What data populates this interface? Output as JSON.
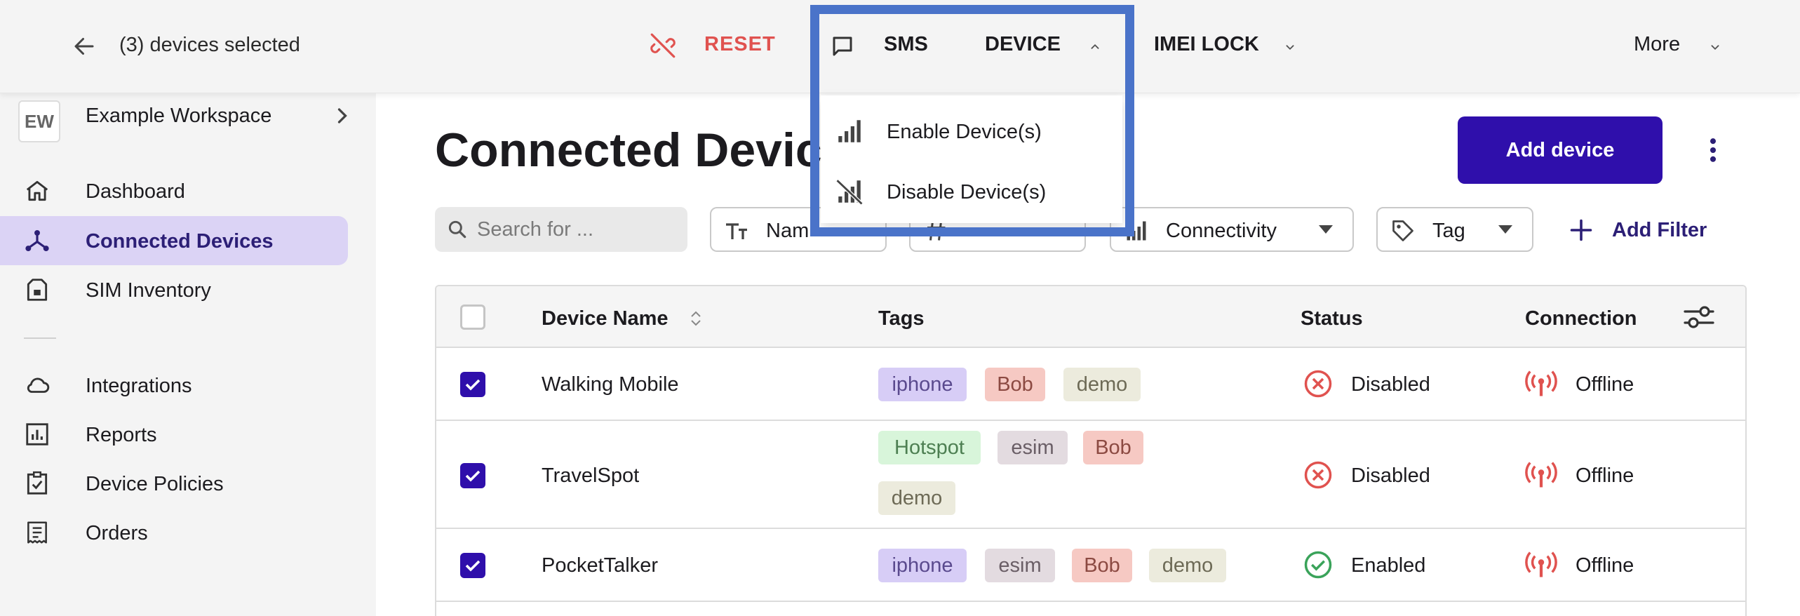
{
  "topbar": {
    "selection_text": "(3) devices selected",
    "reset_label": "RESET",
    "sms_label": "SMS",
    "device_label": "DEVICE",
    "imei_label": "IMEI LOCK",
    "more_label": "More"
  },
  "device_menu": {
    "items": [
      {
        "label": "Enable Device(s)",
        "icon": "signal-bars-icon"
      },
      {
        "label": "Disable Device(s)",
        "icon": "signal-off-icon"
      }
    ]
  },
  "highlight_color": "#4a73c9",
  "sidebar": {
    "workspace_initials": "EW",
    "workspace_name": "Example Workspace",
    "items": [
      {
        "label": "Dashboard",
        "icon": "home-icon"
      },
      {
        "label": "Connected Devices",
        "icon": "network-icon",
        "active": true
      },
      {
        "label": "SIM Inventory",
        "icon": "sim-card-icon"
      },
      {
        "label": "Integrations",
        "icon": "cloud-icon"
      },
      {
        "label": "Reports",
        "icon": "bar-report-icon"
      },
      {
        "label": "Device Policies",
        "icon": "clipboard-check-icon"
      },
      {
        "label": "Orders",
        "icon": "receipt-icon"
      }
    ]
  },
  "main": {
    "title": "Connected Devic",
    "add_device_label": "Add device",
    "search_placeholder": "Search for ...",
    "filters": {
      "name_label": "Nam",
      "connectivity_label": "Connectivity",
      "tag_label": "Tag",
      "add_filter_label": "Add Filter"
    }
  },
  "table": {
    "columns": {
      "device_name": "Device Name",
      "tags": "Tags",
      "status": "Status",
      "connection": "Connection"
    },
    "rows": [
      {
        "name": "Walking Mobile",
        "tags": [
          "iphone",
          "Bob",
          "demo"
        ],
        "status": "Disabled",
        "connection": "Offline",
        "checked": true
      },
      {
        "name": "TravelSpot",
        "tags": [
          "Hotspot",
          "esim",
          "Bob",
          "demo"
        ],
        "status": "Disabled",
        "connection": "Offline",
        "checked": true
      },
      {
        "name": "PocketTalker",
        "tags": [
          "iphone",
          "esim",
          "Bob",
          "demo"
        ],
        "status": "Enabled",
        "connection": "Offline",
        "checked": true
      }
    ]
  },
  "colors": {
    "primary": "#2f0fab",
    "reset": "#e0524f",
    "disabled": "#e0524f",
    "enabled": "#3aa35a",
    "offline": "#e0524f",
    "tag_iphone": "#d7cdf6",
    "tag_bob": "#f6c9c3",
    "tag_demo": "#ecebdd",
    "tag_esim": "#e3dbe0",
    "tag_hotspot": "#d8f5da"
  }
}
